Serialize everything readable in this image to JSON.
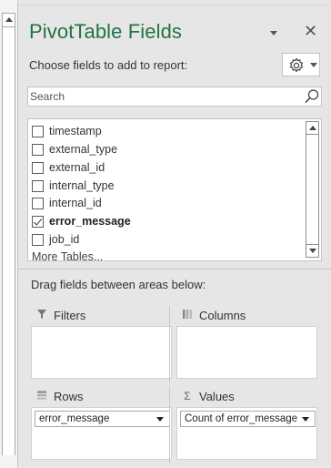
{
  "pane": {
    "title": "PivotTable Fields",
    "choose_label": "Choose fields to add to report:",
    "search_placeholder": "Search",
    "drag_label": "Drag fields between areas below:",
    "accent_color": "#217346"
  },
  "fields": [
    {
      "name": "timestamp",
      "checked": false
    },
    {
      "name": "external_type",
      "checked": false
    },
    {
      "name": "external_id",
      "checked": false
    },
    {
      "name": "internal_type",
      "checked": false
    },
    {
      "name": "internal_id",
      "checked": false
    },
    {
      "name": "error_message",
      "checked": true
    },
    {
      "name": "job_id",
      "checked": false
    }
  ],
  "more_tables": "More Tables...",
  "areas": {
    "filters": {
      "label": "Filters",
      "icon": "filter-icon",
      "items": []
    },
    "columns": {
      "label": "Columns",
      "icon": "columns-icon",
      "items": []
    },
    "rows": {
      "label": "Rows",
      "icon": "rows-icon",
      "items": [
        "error_message"
      ]
    },
    "values": {
      "label": "Values",
      "icon": "sigma-icon",
      "items": [
        "Count of error_message"
      ]
    }
  }
}
